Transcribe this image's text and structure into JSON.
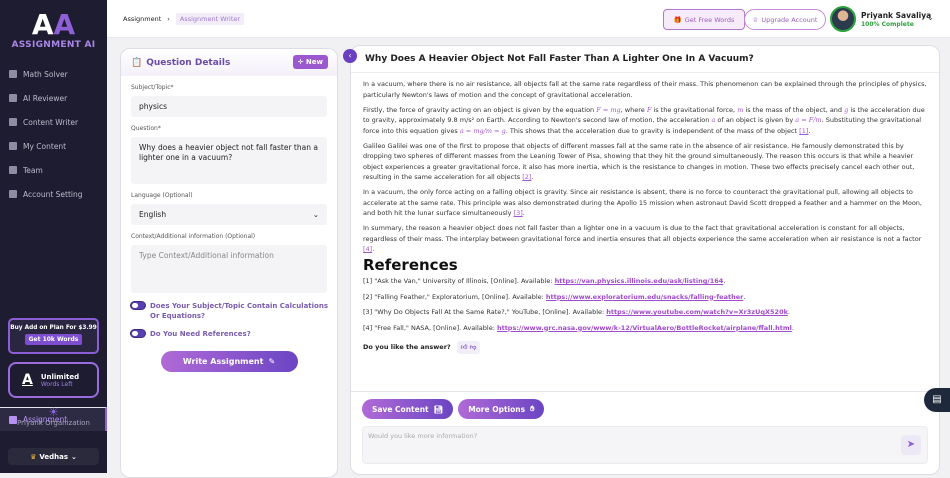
{
  "sidebar": {
    "logo_text": "ASSIGNMENT",
    "logo_ai": "AI",
    "items": [
      {
        "label": "Assignment",
        "active": true
      },
      {
        "label": "Math Solver"
      },
      {
        "label": "AI Reviewer"
      },
      {
        "label": "Content Writer"
      },
      {
        "label": "My Content"
      },
      {
        "label": "Team"
      },
      {
        "label": "Account Setting"
      }
    ],
    "promo": {
      "text": "Buy Add on Plan For $3.99",
      "button": "Get 10k Words"
    },
    "words": {
      "value": "Unlimited",
      "label": "Words Left"
    },
    "org": "Priyank Organization",
    "workspace": "Vedhas"
  },
  "header": {
    "breadcrumb": [
      "Assignment",
      "Assignment Writer"
    ],
    "free_words": "Get Free Words",
    "upgrade": "Upgrade Account",
    "user": "Priyank Savaliya",
    "profile": "100% Complete"
  },
  "form": {
    "title": "Question Details",
    "new_label": "New",
    "subject_label": "Subject/Topic*",
    "subject_value": "physics",
    "question_label": "Question*",
    "question_value": "Why does a heavier object not fall faster than a lighter one in a vacuum?",
    "language_label": "Language (Optional)",
    "language_value": "English",
    "context_label": "Context/Additional information (Optional)",
    "context_placeholder": "Type Context/Additional information",
    "toggle_calc": "Does Your Subject/Topic Contain Calculations Or Equations?",
    "toggle_refs": "Do You Need References?",
    "submit": "Write Assignment"
  },
  "answer": {
    "title": "Why Does A Heavier Object Not Fall Faster Than A Lighter One In A Vacuum?",
    "paragraphs": [
      [
        {
          "t": "In a vacuum, where there is no air resistance, all objects fall at the same rate regardless of their mass. This phenomenon can be explained through the principles of physics, particularly Newton's laws of motion and the concept of gravitational acceleration."
        }
      ],
      [
        {
          "t": "Firstly, the force of gravity acting on an object is given by the equation "
        },
        {
          "m": "F = mg"
        },
        {
          "t": ", where "
        },
        {
          "m": "F"
        },
        {
          "t": " is the gravitational force, "
        },
        {
          "m": "m"
        },
        {
          "t": " is the mass of the object, and "
        },
        {
          "m": "g"
        },
        {
          "t": " is the acceleration due to gravity, approximately 9.8 m/s² on Earth. According to Newton's second law of motion, the acceleration "
        },
        {
          "m": "a"
        },
        {
          "t": " of an object is given by "
        },
        {
          "m": "a = F/m"
        },
        {
          "t": ". Substituting the gravitational force into this equation gives "
        },
        {
          "m": "a = mg/m = g"
        },
        {
          "t": ". This shows that the acceleration due to gravity is independent of the mass of the object "
        },
        {
          "r": "[1]"
        },
        {
          "t": "."
        }
      ],
      [
        {
          "t": "Galileo Galilei was one of the first to propose that objects of different masses fall at the same rate in the absence of air resistance. He famously demonstrated this by dropping two spheres of different masses from the Leaning Tower of Pisa, showing that they hit the ground simultaneously. The reason this occurs is that while a heavier object experiences a greater gravitational force, it also has more inertia, which is the resistance to changes in motion. These two effects precisely cancel each other out, resulting in the same acceleration for all objects "
        },
        {
          "r": "[2]"
        },
        {
          "t": "."
        }
      ],
      [
        {
          "t": "In a vacuum, the only force acting on a falling object is gravity. Since air resistance is absent, there is no force to counteract the gravitational pull, allowing all objects to accelerate at the same rate. This principle was also demonstrated during the Apollo 15 mission when astronaut David Scott dropped a feather and a hammer on the Moon, and both hit the lunar surface simultaneously "
        },
        {
          "r": "[3]"
        },
        {
          "t": "."
        }
      ],
      [
        {
          "t": "In summary, the reason a heavier object does not fall faster than a lighter one in a vacuum is due to the fact that gravitational acceleration is constant for all objects, regardless of their mass. The interplay between gravitational force and inertia ensures that all objects experience the same acceleration when air resistance is not a factor "
        },
        {
          "r": "[4]"
        },
        {
          "t": "."
        }
      ]
    ],
    "references_title": "References",
    "references": [
      {
        "text": "[1] \"Ask the Van,\" University of Illinois, [Online]. Available: ",
        "url": "https://van.physics.illinois.edu/ask/listing/164"
      },
      {
        "text": "[2] \"Falling Feather,\" Exploratorium, [Online]. Available: ",
        "url": "https://www.exploratorium.edu/snacks/falling-feather"
      },
      {
        "text": "[3] \"Why Do Objects Fall At the Same Rate?,\" YouTube, [Online]. Available: ",
        "url": "https://www.youtube.com/watch?v=Xr3zUqX520k"
      },
      {
        "text": "[4] \"Free Fall,\" NASA, [Online]. Available: ",
        "url": "https://www.grc.nasa.gov/www/k-12/VirtualAero/BottleRocket/airplane/ffall.html"
      }
    ],
    "like_prompt": "Do you like the answer?",
    "save": "Save Content",
    "more": "More Options",
    "chat_placeholder": "Would you like more information?"
  },
  "colors": {
    "accent": "#8d5fe0",
    "sidebar_bg": "#1d1c30",
    "success": "#2aa33c"
  }
}
